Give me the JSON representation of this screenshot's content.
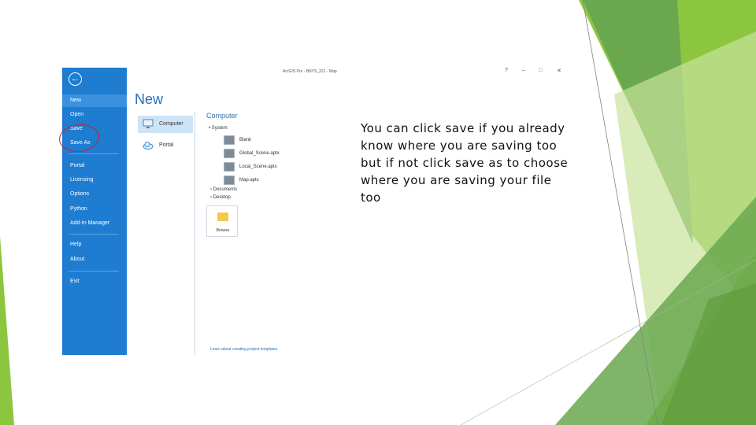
{
  "slide": {
    "caption": "You can click save if you already know where you are saving too but if not click save as to choose where you are saving your file too",
    "accent_colors": [
      "#8cc63f",
      "#6aa84f",
      "#5c9a3a",
      "#c8e39b"
    ]
  },
  "app": {
    "window_title": "ArcGIS Pro - BNYS_221 - Map",
    "window_controls": {
      "help": "?",
      "minimize": "–",
      "restore": "□",
      "close": "✕"
    }
  },
  "backstage": {
    "back_icon": "back-arrow-icon",
    "menu": [
      "New",
      "Open",
      "Save",
      "Save As",
      "Portal",
      "Licensing",
      "Options",
      "Python",
      "Add-In Manager",
      "Help",
      "About",
      "Exit"
    ],
    "active_item": "New",
    "highlight_color": "#cc2222"
  },
  "content": {
    "heading": "New",
    "locations": [
      {
        "label": "Computer",
        "icon": "computer-icon"
      },
      {
        "label": "Portal",
        "icon": "cloud-icon"
      }
    ],
    "section_title": "Computer",
    "system_label": "• System",
    "templates": [
      "Blank",
      "Global_Scene.aptx",
      "Local_Scene.aptx",
      "Map.aptx"
    ],
    "folders": [
      "› Documents",
      "› Desktop"
    ],
    "browse_label": "Browse",
    "learn_link": "Learn about creating project templates"
  }
}
